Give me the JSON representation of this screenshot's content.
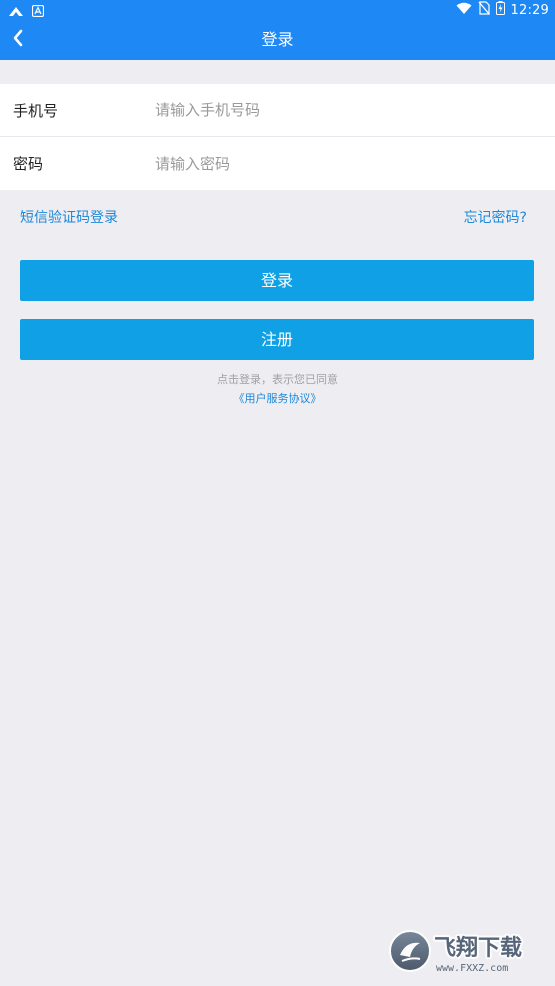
{
  "status_bar": {
    "time": "12:29",
    "icons": [
      "app-a-icon",
      "app-b-icon",
      "wifi-icon",
      "no-sim-icon",
      "battery-charging-icon"
    ]
  },
  "app_bar": {
    "title": "登录",
    "back_icon": "chevron-left-icon",
    "background": "#1E88F5"
  },
  "form": {
    "phone": {
      "label": "手机号",
      "placeholder": "请输入手机号码",
      "value": ""
    },
    "password": {
      "label": "密码",
      "placeholder": "请输入密码",
      "value": ""
    }
  },
  "links": {
    "sms_login": "短信验证码登录",
    "forgot_password": "忘记密码?"
  },
  "buttons": {
    "login": "登录",
    "register": "注册",
    "color": "#0FA0E6"
  },
  "agreement": {
    "text": "点击登录，表示您已同意",
    "link": "《用户服务协议》"
  },
  "watermark": {
    "brand": "飞翔下载",
    "url": "www.FXXZ.com"
  }
}
